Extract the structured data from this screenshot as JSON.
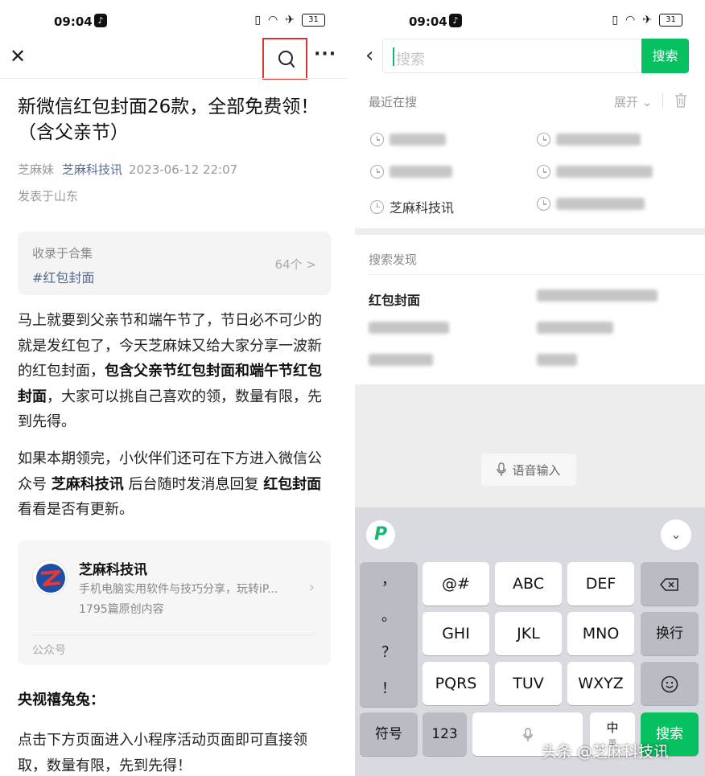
{
  "left": {
    "status": {
      "time": "09:04",
      "battery": "31"
    },
    "title": "新微信红包封面26款，全部免费领！（含父亲节）",
    "meta": {
      "author": "芝麻妹",
      "account": "芝麻科技讯",
      "datetime": "2023-06-12 22:07",
      "location": "发表于山东"
    },
    "collection": {
      "label": "收录于合集",
      "tag": "#红包封面",
      "count": "64个 >"
    },
    "para1": {
      "a": "马上就要到父亲节和端午节了，节日必不可少的就是发红包了，今天芝麻妹又给大家分享一波新的红包封面，",
      "b": "包含父亲节红包封面和端午节红包封面",
      "c": "，大家可以挑自己喜欢的领，数量有限，先到先得。"
    },
    "para2": {
      "a": "如果本期领完，小伙伴们还可在下方进入微信公众号 ",
      "b": "芝麻科技讯",
      "c": " 后台随时发消息回复 ",
      "d": "红包封面",
      "e": " 看看是否有更新。"
    },
    "card": {
      "name": "芝麻科技讯",
      "desc": "手机电脑实用软件与技巧分享，玩转iP...",
      "posts": "1795篇原创内容",
      "type": "公众号"
    },
    "section_heading": "央视禧兔兔：",
    "para3": "点击下方页面进入小程序活动页面即可直接领取，数量有限，先到先得！"
  },
  "right": {
    "status": {
      "time": "09:04",
      "battery": "31"
    },
    "search": {
      "placeholder": "搜索",
      "button": "搜索"
    },
    "recent": {
      "label": "最近在搜",
      "expand": "展开",
      "visible_item": "芝麻科技讯"
    },
    "discover": {
      "label": "搜索发现",
      "item1": "红包封面"
    },
    "voice": "语音输入",
    "keyboard": {
      "punct": [
        "，",
        "。",
        "？",
        "！"
      ],
      "row1": [
        "@#",
        "ABC",
        "DEF"
      ],
      "row2": [
        "GHI",
        "JKL",
        "MNO"
      ],
      "row3": [
        "PQRS",
        "TUV",
        "WXYZ"
      ],
      "newline": "换行",
      "symbols": "符号",
      "num": "123",
      "lang_main": "中",
      "lang_sub": "英",
      "go": "搜索"
    },
    "watermark": "头条 @芝麻科技讯"
  },
  "colors": {
    "accent": "#07c160",
    "highlight_box": "#d83434",
    "link": "#576b95"
  }
}
